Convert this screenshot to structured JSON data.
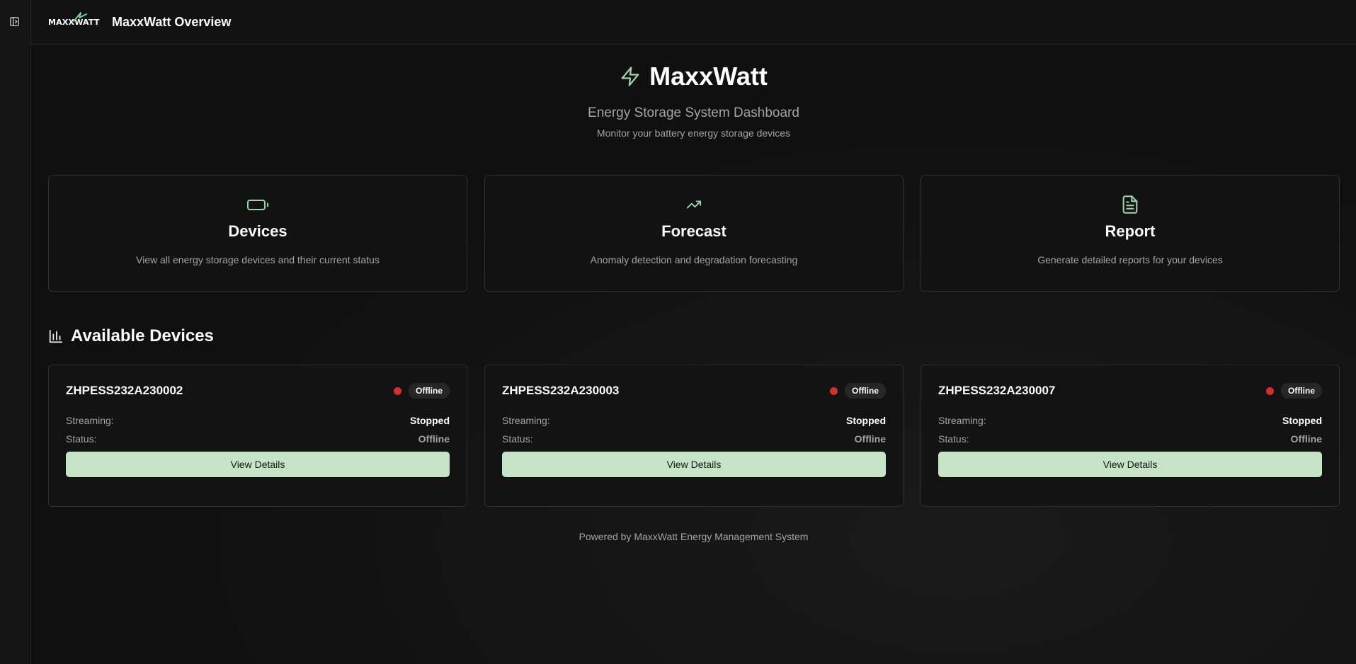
{
  "app": {
    "logo_text": "MAXXWATT",
    "title": "MaxxWatt Overview"
  },
  "hero": {
    "title": "MaxxWatt",
    "subtitle": "Energy Storage System Dashboard",
    "caption": "Monitor your battery energy storage devices"
  },
  "features": [
    {
      "icon": "battery-icon",
      "title": "Devices",
      "desc": "View all energy storage devices and their current status"
    },
    {
      "icon": "trending-up-icon",
      "title": "Forecast",
      "desc": "Anomaly detection and degradation forecasting"
    },
    {
      "icon": "file-text-icon",
      "title": "Report",
      "desc": "Generate detailed reports for your devices"
    }
  ],
  "section": {
    "title": "Available Devices",
    "icon": "bar-chart-icon"
  },
  "devices": [
    {
      "name": "ZHPESS232A230002",
      "badge": "Offline",
      "streaming_label": "Streaming:",
      "streaming_value": "Stopped",
      "status_label": "Status:",
      "status_value": "Offline",
      "button": "View Details"
    },
    {
      "name": "ZHPESS232A230003",
      "badge": "Offline",
      "streaming_label": "Streaming:",
      "streaming_value": "Stopped",
      "status_label": "Status:",
      "status_value": "Offline",
      "button": "View Details"
    },
    {
      "name": "ZHPESS232A230007",
      "badge": "Offline",
      "streaming_label": "Streaming:",
      "streaming_value": "Stopped",
      "status_label": "Status:",
      "status_value": "Offline",
      "button": "View Details"
    }
  ],
  "footer": {
    "text": "Powered by MaxxWatt Energy Management System"
  },
  "colors": {
    "accent": "#c6e5c8",
    "offline_dot": "#d32f2f",
    "background": "#101010"
  }
}
